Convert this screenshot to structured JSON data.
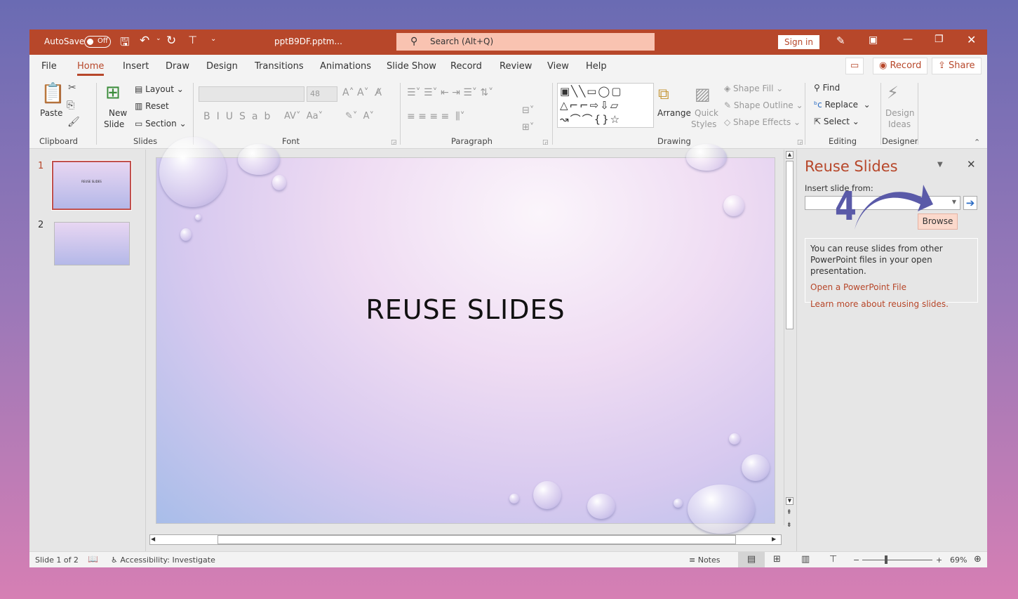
{
  "titlebar": {
    "autosave": "AutoSave",
    "autosave_state": "Off",
    "filename": "pptB9DF.pptm...",
    "search_placeholder": "Search (Alt+Q)",
    "sign_in": "Sign in",
    "accent": "#b7472a"
  },
  "tabs": [
    "File",
    "Home",
    "Insert",
    "Draw",
    "Design",
    "Transitions",
    "Animations",
    "Slide Show",
    "Record",
    "Review",
    "View",
    "Help"
  ],
  "active_tab": "Home",
  "ribbon_buttons": {
    "record": "Record",
    "share": "Share"
  },
  "ribbon": {
    "clipboard": {
      "label": "Clipboard",
      "paste": "Paste"
    },
    "slides": {
      "label": "Slides",
      "new_slide_1": "New",
      "new_slide_2": "Slide",
      "layout": "Layout",
      "reset": "Reset",
      "section": "Section"
    },
    "font": {
      "label": "Font",
      "font_name": "",
      "font_size": "48"
    },
    "paragraph": {
      "label": "Paragraph"
    },
    "drawing": {
      "label": "Drawing",
      "arrange": "Arrange",
      "quick_styles_1": "Quick",
      "quick_styles_2": "Styles",
      "shape_fill": "Shape Fill",
      "shape_outline": "Shape Outline",
      "shape_effects": "Shape Effects"
    },
    "editing": {
      "label": "Editing",
      "find": "Find",
      "replace": "Replace",
      "select": "Select"
    },
    "designer": {
      "label": "Designer",
      "design_ideas_1": "Design",
      "design_ideas_2": "Ideas"
    }
  },
  "thumbnails": [
    {
      "number": "1",
      "title": "REUSE SLIDES",
      "selected": true
    },
    {
      "number": "2",
      "selected": false
    }
  ],
  "slide": {
    "title": "REUSE SLIDES"
  },
  "reuse_pane": {
    "title": "Reuse Slides",
    "insert_label": "Insert slide from:",
    "input_value": "",
    "browse": "Browse",
    "step_number": "4",
    "info": "You can reuse slides from other PowerPoint files in your open presentation.",
    "link_open": "Open a PowerPoint File",
    "link_learn": "Learn more about reusing slides."
  },
  "status": {
    "slide_info": "Slide 1 of 2",
    "accessibility": "Accessibility: Investigate",
    "notes": "Notes",
    "zoom": "69%"
  }
}
